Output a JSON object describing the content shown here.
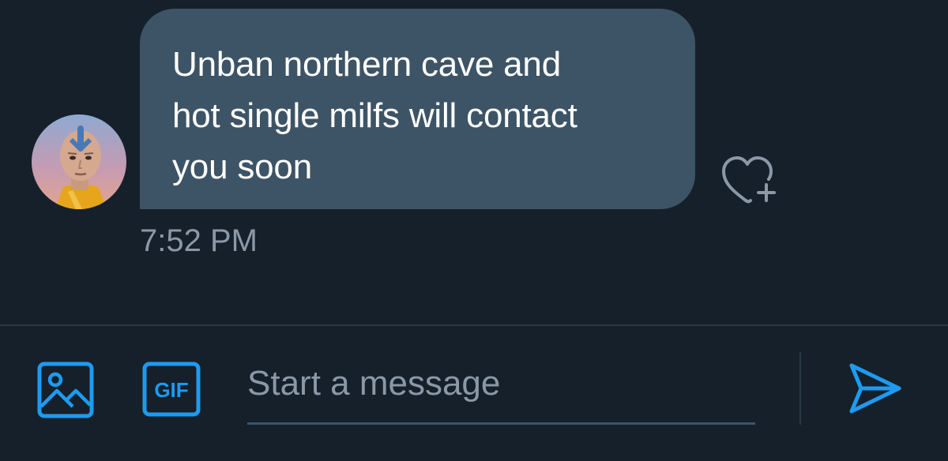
{
  "conversation": {
    "message": {
      "text": "Unban northern cave and\nhot single milfs will contact\nyou soon",
      "timestamp": "7:52 PM",
      "bubble_color": "#3d5466"
    },
    "avatar": {
      "description_icon": "user-avatar"
    },
    "react_icon": "heart-plus-icon"
  },
  "composer": {
    "placeholder": "Start a message",
    "value": "",
    "gif_label": "GIF",
    "media_icon": "image-icon",
    "send_icon": "send-icon",
    "accent_color": "#1d9bf0"
  },
  "theme": {
    "background": "#15202b",
    "secondary_text": "#8b98a5",
    "divider": "#2a3845"
  }
}
